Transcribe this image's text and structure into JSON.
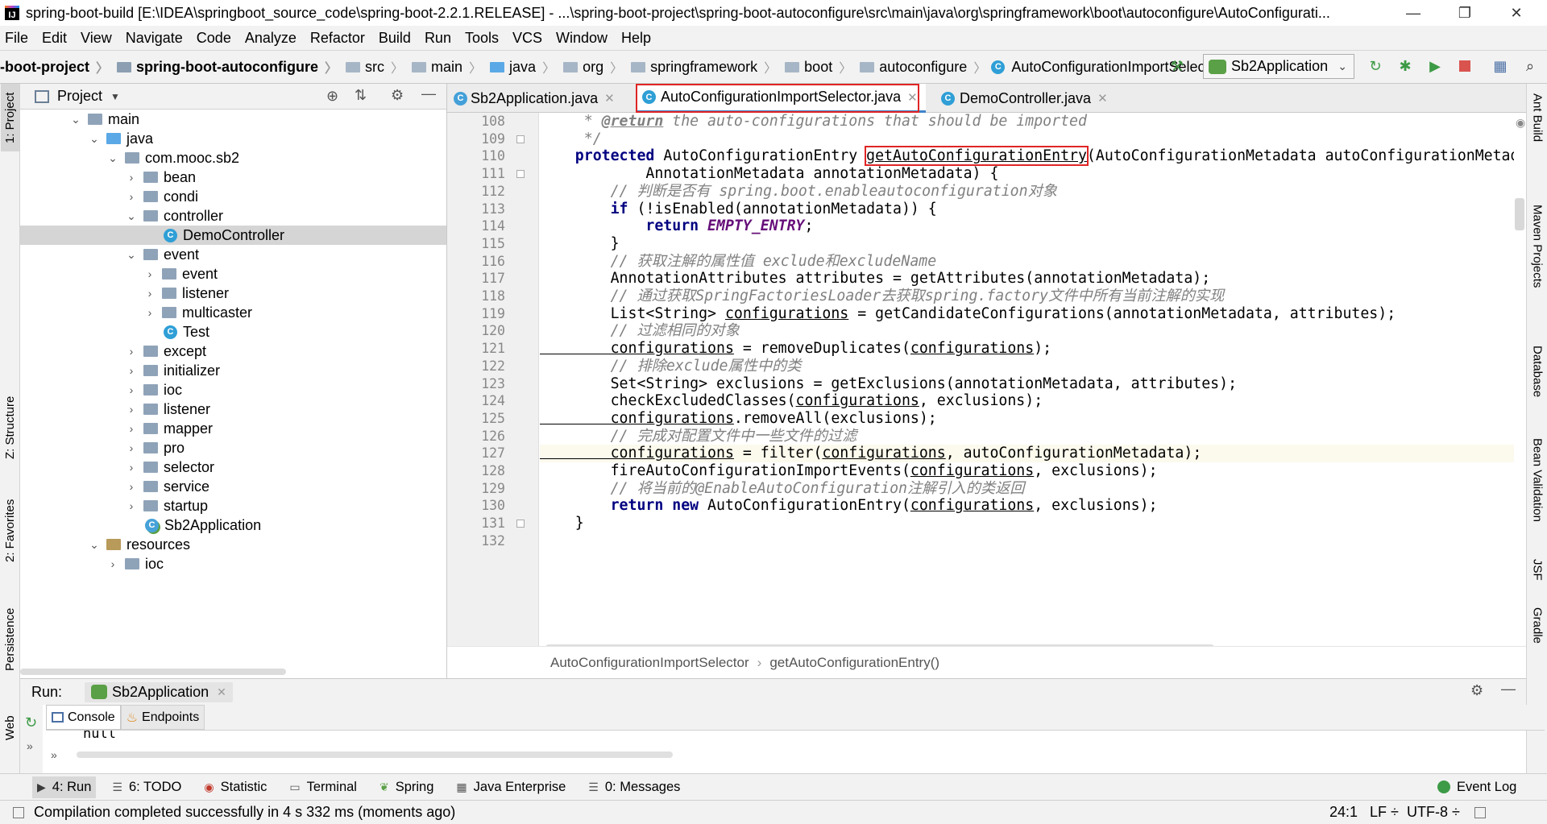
{
  "window": {
    "title": "spring-boot-build [E:\\IDEA\\springboot_source_code\\spring-boot-2.2.1.RELEASE] - ...\\spring-boot-project\\spring-boot-autoconfigure\\src\\main\\java\\org\\springframework\\boot\\autoconfigure\\AutoConfigurati...",
    "app_icon": "IJ",
    "minimize": "—",
    "maximize": "❐",
    "close": "✕"
  },
  "menu": [
    "File",
    "Edit",
    "View",
    "Navigate",
    "Code",
    "Analyze",
    "Refactor",
    "Build",
    "Run",
    "Tools",
    "VCS",
    "Window",
    "Help"
  ],
  "breadcrumbs": [
    "-boot-project",
    "spring-boot-autoconfigure",
    "src",
    "main",
    "java",
    "org",
    "springframework",
    "boot",
    "autoconfigure",
    "AutoConfigurationImportSelector"
  ],
  "run_config": {
    "label": "Sb2Application"
  },
  "left_tool_tabs": [
    "1: Project",
    "Z: Structure",
    "2: Favorites",
    "Persistence",
    "Web"
  ],
  "right_tool_tabs": [
    "Ant Build",
    "Maven Projects",
    "Database",
    "Bean Validation",
    "JSF",
    "Gradle"
  ],
  "project_panel": {
    "title": "Project",
    "tree": [
      {
        "label": "main",
        "arrow": "⌄",
        "icon": "folder"
      },
      {
        "label": "java",
        "arrow": "⌄",
        "icon": "java"
      },
      {
        "label": "com.mooc.sb2",
        "arrow": "⌄",
        "icon": "folder"
      },
      {
        "label": "bean",
        "arrow": "›",
        "icon": "folder"
      },
      {
        "label": "condi",
        "arrow": "›",
        "icon": "folder"
      },
      {
        "label": "controller",
        "arrow": "⌄",
        "icon": "folder"
      },
      {
        "label": "DemoController",
        "arrow": "",
        "icon": "class",
        "selected": true
      },
      {
        "label": "event",
        "arrow": "⌄",
        "icon": "folder"
      },
      {
        "label": "event",
        "arrow": "›",
        "icon": "folder"
      },
      {
        "label": "listener",
        "arrow": "›",
        "icon": "folder"
      },
      {
        "label": "multicaster",
        "arrow": "›",
        "icon": "folder"
      },
      {
        "label": "Test",
        "arrow": "",
        "icon": "class"
      },
      {
        "label": "except",
        "arrow": "›",
        "icon": "folder"
      },
      {
        "label": "initializer",
        "arrow": "›",
        "icon": "folder"
      },
      {
        "label": "ioc",
        "arrow": "›",
        "icon": "folder"
      },
      {
        "label": "listener",
        "arrow": "›",
        "icon": "folder"
      },
      {
        "label": "mapper",
        "arrow": "›",
        "icon": "folder"
      },
      {
        "label": "pro",
        "arrow": "›",
        "icon": "folder"
      },
      {
        "label": "selector",
        "arrow": "›",
        "icon": "folder"
      },
      {
        "label": "service",
        "arrow": "›",
        "icon": "folder"
      },
      {
        "label": "startup",
        "arrow": "›",
        "icon": "folder"
      },
      {
        "label": "Sb2Application",
        "arrow": "",
        "icon": "spring"
      },
      {
        "label": "resources",
        "arrow": "⌄",
        "icon": "res"
      },
      {
        "label": "ioc",
        "arrow": "›",
        "icon": "folder"
      }
    ]
  },
  "editor": {
    "tabs": [
      {
        "label": "Sb2Application.java",
        "active": false
      },
      {
        "label": "AutoConfigurationImportSelector.java",
        "active": true
      },
      {
        "label": "DemoController.java",
        "active": false
      }
    ],
    "current_line": 127,
    "lines": [
      {
        "n": "108",
        "segs": [
          [
            "cm",
            "     * "
          ],
          [
            "cm ul kwb",
            "@return"
          ],
          [
            "cm",
            " the auto-configurations that should be imported"
          ]
        ]
      },
      {
        "n": "109",
        "segs": [
          [
            "cm",
            "     */"
          ]
        ]
      },
      {
        "n": "110",
        "segs": [
          [
            "kw",
            "    protected "
          ],
          [
            "",
            "AutoConfigurationEntry "
          ],
          [
            "ul box",
            "getAutoConfigurationEntry"
          ],
          [
            "",
            "(AutoConfigurationMetadata autoConfigurationMetadata,"
          ]
        ]
      },
      {
        "n": "111",
        "segs": [
          [
            "",
            "            AnnotationMetadata annotationMetadata) {"
          ]
        ]
      },
      {
        "n": "112",
        "segs": [
          [
            "cm",
            "        // 判断是否有 spring.boot.enableautoconfiguration对象"
          ]
        ]
      },
      {
        "n": "113",
        "segs": [
          [
            "kw",
            "        if "
          ],
          [
            "",
            "(!isEnabled(annotationMetadata)) {"
          ]
        ]
      },
      {
        "n": "114",
        "segs": [
          [
            "kw",
            "            return "
          ],
          [
            "cst",
            "EMPTY_ENTRY"
          ],
          [
            "",
            ";"
          ]
        ]
      },
      {
        "n": "115",
        "segs": [
          [
            "",
            "        }"
          ]
        ]
      },
      {
        "n": "116",
        "segs": [
          [
            "cm",
            "        // 获取注解的属性值 exclude和excludeName"
          ]
        ]
      },
      {
        "n": "117",
        "segs": [
          [
            "",
            "        AnnotationAttributes attributes = getAttributes(annotationMetadata);"
          ]
        ]
      },
      {
        "n": "118",
        "segs": [
          [
            "cm",
            "        // 通过获取SpringFactoriesLoader去获取spring.factory文件中所有当前注解的实现"
          ]
        ]
      },
      {
        "n": "119",
        "segs": [
          [
            "",
            "        List<String> "
          ],
          [
            "ul",
            "configurations"
          ],
          [
            "",
            " = getCandidateConfigurations(annotationMetadata, attributes);"
          ]
        ]
      },
      {
        "n": "120",
        "segs": [
          [
            "cm",
            "        // 过滤相同的对象"
          ]
        ]
      },
      {
        "n": "121",
        "segs": [
          [
            "ul",
            "        configurations"
          ],
          [
            "",
            " = removeDuplicates("
          ],
          [
            "ul",
            "configurations"
          ],
          [
            "",
            ");"
          ]
        ]
      },
      {
        "n": "122",
        "segs": [
          [
            "cm",
            "        // 排除exclude属性中的类"
          ]
        ]
      },
      {
        "n": "123",
        "segs": [
          [
            "",
            "        Set<String> exclusions = getExclusions(annotationMetadata, attributes);"
          ]
        ]
      },
      {
        "n": "124",
        "segs": [
          [
            "",
            "        checkExcludedClasses("
          ],
          [
            "ul",
            "configurations"
          ],
          [
            "",
            ", exclusions);"
          ]
        ]
      },
      {
        "n": "125",
        "segs": [
          [
            "ul",
            "        configurations"
          ],
          [
            "",
            ".removeAll(exclusions);"
          ]
        ]
      },
      {
        "n": "126",
        "segs": [
          [
            "cm",
            "        // 完成对配置文件中一些文件的过滤"
          ]
        ]
      },
      {
        "n": "127",
        "segs": [
          [
            "ul",
            "        configurations"
          ],
          [
            "",
            " = filter("
          ],
          [
            "ul",
            "configurations"
          ],
          [
            "",
            ", autoConfigurationMetadata);"
          ]
        ]
      },
      {
        "n": "128",
        "segs": [
          [
            "",
            "        fireAutoConfigurationImportEvents("
          ],
          [
            "ul",
            "configurations"
          ],
          [
            "",
            ", exclusions);"
          ]
        ]
      },
      {
        "n": "129",
        "segs": [
          [
            "cm",
            "        // 将当前的@EnableAutoConfiguration注解引入的类返回"
          ]
        ]
      },
      {
        "n": "130",
        "segs": [
          [
            "kw",
            "        return new "
          ],
          [
            "",
            "AutoConfigurationEntry("
          ],
          [
            "ul",
            "configurations"
          ],
          [
            "",
            ", exclusions);"
          ]
        ]
      },
      {
        "n": "131",
        "segs": [
          [
            "",
            "    }"
          ]
        ]
      },
      {
        "n": "132",
        "segs": [
          [
            "",
            ""
          ]
        ]
      }
    ],
    "breadcrumb": [
      "AutoConfigurationImportSelector",
      "getAutoConfigurationEntry()"
    ],
    "breadcrumb_sep": "›"
  },
  "run_panel": {
    "label": "Run:",
    "config": "Sb2Application",
    "tabs": [
      "Console",
      "Endpoints"
    ],
    "output": "null",
    "more": "»"
  },
  "bottom_tools": [
    {
      "label": "4: Run",
      "icon": "▶"
    },
    {
      "label": "6: TODO",
      "icon": "☰"
    },
    {
      "label": "Statistic",
      "icon": "◉"
    },
    {
      "label": "Terminal",
      "icon": "▭"
    },
    {
      "label": "Spring",
      "icon": "❦"
    },
    {
      "label": "Java Enterprise",
      "icon": "▦"
    },
    {
      "label": "0: Messages",
      "icon": "☰"
    }
  ],
  "event_log": "Event Log",
  "status": {
    "message": "Compilation completed successfully in 4 s 332 ms (moments ago)",
    "position": "24:1",
    "line_sep": "LF ÷",
    "encoding": "UTF-8 ÷"
  },
  "colors": {
    "accent": "#4083c9",
    "highlight_box": "#e02525",
    "comment": "#808080",
    "keyword": "#000080",
    "constant": "#660e7a"
  }
}
